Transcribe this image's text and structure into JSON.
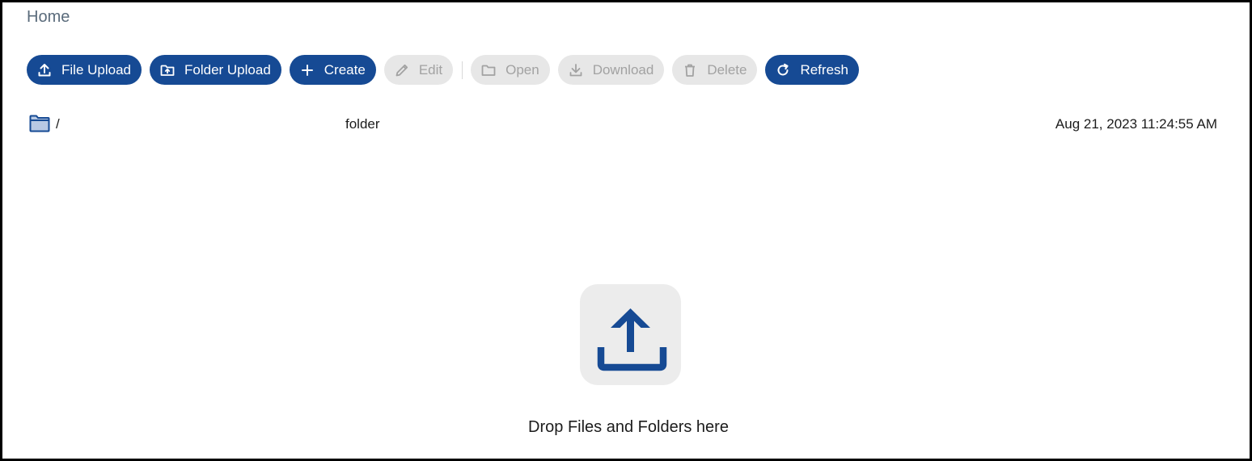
{
  "breadcrumb": {
    "label": "Home"
  },
  "toolbar": {
    "file_upload": {
      "label": "File Upload",
      "icon": "upload-icon"
    },
    "folder_upload": {
      "label": "Folder Upload",
      "icon": "folder-upload-icon"
    },
    "create": {
      "label": "Create",
      "icon": "plus-icon"
    },
    "edit": {
      "label": "Edit",
      "icon": "pencil-icon",
      "disabled": true
    },
    "open": {
      "label": "Open",
      "icon": "folder-open-icon",
      "disabled": true
    },
    "download": {
      "label": "Download",
      "icon": "download-icon",
      "disabled": true
    },
    "delete": {
      "label": "Delete",
      "icon": "trash-icon",
      "disabled": true
    },
    "refresh": {
      "label": "Refresh",
      "icon": "refresh-icon"
    }
  },
  "listing": {
    "rows": [
      {
        "icon": "folder-icon",
        "name": "/",
        "type": "folder",
        "modified": "Aug 21, 2023 11:24:55 AM"
      }
    ]
  },
  "dropzone": {
    "icon": "upload-icon",
    "text": "Drop Files and Folders here"
  },
  "colors": {
    "primary": "#164a94",
    "disabled_bg": "#e7e7e7",
    "disabled_text": "#a2a2a2",
    "folder_fill": "#b8c9e4",
    "dropzone_bg": "#ececec"
  }
}
